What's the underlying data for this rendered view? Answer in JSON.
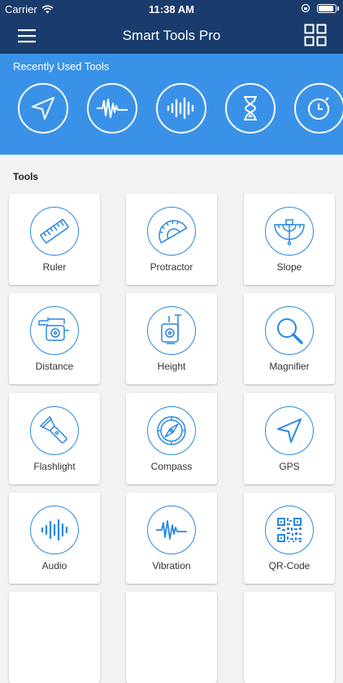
{
  "status": {
    "carrier": "Carrier",
    "time": "11:38 AM"
  },
  "header": {
    "title": "Smart Tools Pro"
  },
  "recent": {
    "label": "Recently Used Tools",
    "items": [
      {
        "icon": "navigation-arrow-icon"
      },
      {
        "icon": "vibration-wave-icon"
      },
      {
        "icon": "audio-wave-icon"
      },
      {
        "icon": "hourglass-icon"
      },
      {
        "icon": "stopwatch-icon"
      }
    ]
  },
  "tools": {
    "title": "Tools",
    "items": [
      {
        "label": "Ruler",
        "icon": "ruler-icon"
      },
      {
        "label": "Protractor",
        "icon": "protractor-icon"
      },
      {
        "label": "Slope",
        "icon": "slope-icon"
      },
      {
        "label": "Distance",
        "icon": "distance-icon"
      },
      {
        "label": "Height",
        "icon": "height-icon"
      },
      {
        "label": "Magnifier",
        "icon": "magnifier-icon"
      },
      {
        "label": "Flashlight",
        "icon": "flashlight-icon"
      },
      {
        "label": "Compass",
        "icon": "compass-icon"
      },
      {
        "label": "GPS",
        "icon": "gps-icon"
      },
      {
        "label": "Audio",
        "icon": "audio-icon"
      },
      {
        "label": "Vibration",
        "icon": "vibration-icon"
      },
      {
        "label": "QR-Code",
        "icon": "qr-code-icon"
      }
    ]
  },
  "colors": {
    "header": "#1a3c6c",
    "accent": "#3a92e8",
    "icon": "#2a88e0"
  }
}
